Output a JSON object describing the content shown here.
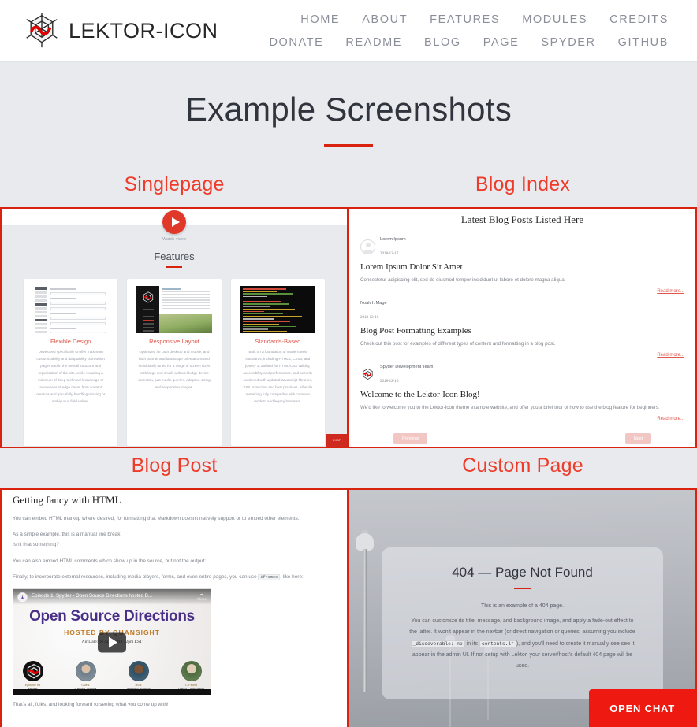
{
  "navbar": {
    "brand": "LEKTOR-ICON",
    "logo_icon": "spyder-web-icon",
    "links": [
      "HOME",
      "ABOUT",
      "FEATURES",
      "MODULES",
      "CREDITS",
      "DONATE",
      "README",
      "BLOG",
      "PAGE",
      "SPYDER",
      "GITHUB"
    ]
  },
  "page": {
    "title": "Example Screenshots",
    "accent_color": "#d9230f",
    "background_color": "#e8eaee"
  },
  "shots": {
    "singlepage": {
      "label": "Singlepage",
      "watch_video": "Watch video",
      "features_heading": "Features",
      "play_icon": "play-circle-icon",
      "chat_badge": "CHAT",
      "cards": [
        {
          "title": "Flexible Design",
          "text": "Developed specifically to offer maximum customizability and adaptability both within pages and in the overall structure and organization of the site, while requiring a minimum of deep technical knowledge or awareness of edge cases from content creators and gracefully handling missing or ambiguous field values.",
          "thumb": "admin-form-screenshot"
        },
        {
          "title": "Responsive Layout",
          "text": "Optimized for both desktop and mobile, and both portrait and landscape orientations and individually tuned for a range of screen sizes both large and small, without kludgy device detection, just media queries, adaptive sizing and responsive images.",
          "thumb": "responsive-site-screenshot"
        },
        {
          "title": "Standards-Based",
          "text": "Built on a foundation of modern web standards, including HTML5, CSS3, and jQuery 3, audited for HTML/CSS validity, accessibility and performance, and security hardened with updated Javascript libraries, XSS protection and best practices, all while remaining fully compatible with common modern and legacy browsers.",
          "thumb": "source-code-screenshot"
        }
      ]
    },
    "blog_index": {
      "label": "Blog Index",
      "heading": "Latest Blog Posts Listed Here",
      "read_more": "Read more...",
      "prev_label": "Previous",
      "next_label": "Next",
      "posts": [
        {
          "author": "Lorem Ipsum",
          "date": "2018-12-17",
          "avatar": "generic-person-avatar",
          "title": "Lorem Ipsum Dolor Sit Amet",
          "excerpt": "Consectetur adipiscing elit, sed do eiusmod tempor incididunt ut labore et dolore magna aliqua."
        },
        {
          "author": "Noah I. Mage",
          "date": "2018-12-16",
          "avatar": "none",
          "title": "Blog Post Formatting Examples",
          "excerpt": "Check out this post for examples of different types of content and formatting in a blog post."
        },
        {
          "author": "Spyder Development Team",
          "date": "2018-12-16",
          "avatar": "spyder-web-icon",
          "title": "Welcome to the Lektor-Icon Blog!",
          "excerpt": "We'd like to welcome you to the Lektor-Icon theme example website, and offer you a brief tour of how to use the blog feature for beginners."
        }
      ]
    },
    "blog_post": {
      "label": "Blog Post",
      "heading": "Getting fancy with HTML",
      "paragraphs": [
        "You can embed HTML markup where desired, for formatting that Markdown doesn't natively support or to embed other elements.",
        "As a simple example, this is a manual line break.",
        "Isn't that something?",
        "You can also embed HTML comments which show up in the source, but not the output:"
      ],
      "iframe_line_pre": "Finally, to incorporate external resources, including media players, forms, and even entire pages, you can use ",
      "iframe_code": "iframes",
      "iframe_line_post": ", like here:",
      "closing": "That's all, folks, and looking forward to seeing what you come up with!",
      "video": {
        "yt_title": "Episode 1: Spyder - Open Source Directions hosted B...",
        "share_label": "Share",
        "title": "Open Source Directions",
        "hosted_by": "HOSTED BY QUANSIGHT",
        "air_date": "Air Date: 16 Aug. 2018 12pm EST",
        "play_icon": "youtube-play-icon",
        "people": [
          {
            "role": "Episode on",
            "name": "Spyder",
            "face": "spyder-web-icon"
          },
          {
            "role": "Guest",
            "name": "Carlos Cordoba",
            "face": "photo-avatar"
          },
          {
            "role": "Host",
            "name": "Anthony Scopatz",
            "face": "photo-avatar"
          },
          {
            "role": "Co-Host",
            "name": "David Charboneau",
            "face": "photo-avatar"
          }
        ]
      }
    },
    "custom_page": {
      "label": "Custom Page",
      "title": "404 — Page Not Found",
      "lead": "This is an example of a 404 page.",
      "body_pre": "You can customize its title, message, and background image, and apply a fade-out effect to the latter. It won't appear in the navbar (or direct navigation or queries, assuming you include ",
      "code_1": "_discoverable: no",
      "body_mid": " in its ",
      "code_2": "contents.lr",
      "body_post": "), and you'll need to create it manually see see it appear in the admin UI. If not setup with Lektor, your server/host's default 404 page will be used.",
      "chat_button": "OPEN CHAT",
      "chat_color": "#ee1a12"
    }
  }
}
